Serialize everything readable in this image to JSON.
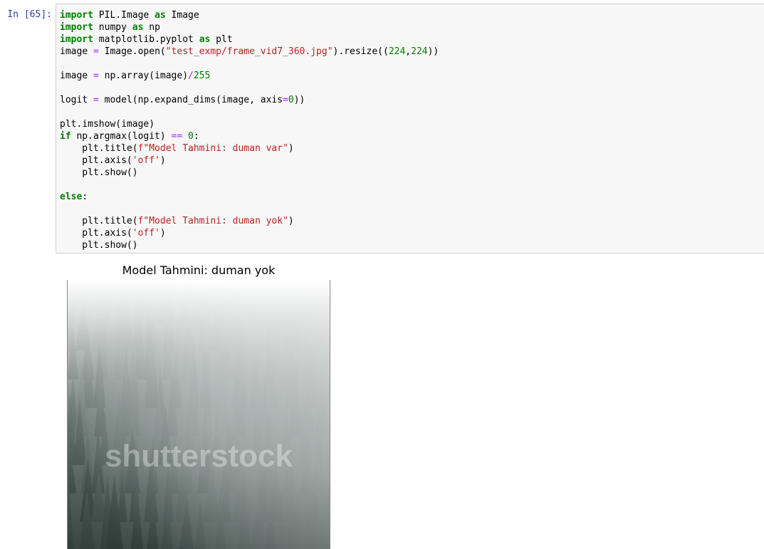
{
  "cell": {
    "prompt": "In [65]:",
    "code_lines": [
      [
        {
          "t": "import",
          "c": "kw"
        },
        {
          "t": " PIL.Image "
        },
        {
          "t": "as",
          "c": "kw"
        },
        {
          "t": " Image"
        }
      ],
      [
        {
          "t": "import",
          "c": "kw"
        },
        {
          "t": " numpy "
        },
        {
          "t": "as",
          "c": "kw"
        },
        {
          "t": " np"
        }
      ],
      [
        {
          "t": "import",
          "c": "kw"
        },
        {
          "t": " matplotlib.pyplot "
        },
        {
          "t": "as",
          "c": "kw"
        },
        {
          "t": " plt"
        }
      ],
      [
        {
          "t": "image "
        },
        {
          "t": "=",
          "c": "op"
        },
        {
          "t": " Image.open("
        },
        {
          "t": "\"test_exmp/frame_vid7_360.jpg\"",
          "c": "st"
        },
        {
          "t": ").resize(("
        },
        {
          "t": "224",
          "c": "nu"
        },
        {
          "t": ","
        },
        {
          "t": "224",
          "c": "nu"
        },
        {
          "t": "))"
        }
      ],
      [],
      [
        {
          "t": "image "
        },
        {
          "t": "=",
          "c": "op"
        },
        {
          "t": " np.array(image)"
        },
        {
          "t": "/",
          "c": "op"
        },
        {
          "t": "255",
          "c": "nu"
        }
      ],
      [],
      [
        {
          "t": "logit "
        },
        {
          "t": "=",
          "c": "op"
        },
        {
          "t": " model(np.expand_dims(image, axis"
        },
        {
          "t": "=",
          "c": "op"
        },
        {
          "t": "0",
          "c": "nu"
        },
        {
          "t": "))"
        }
      ],
      [],
      [
        {
          "t": "plt.imshow(image)"
        }
      ],
      [
        {
          "t": "if",
          "c": "kw"
        },
        {
          "t": " np.argmax(logit) "
        },
        {
          "t": "==",
          "c": "op"
        },
        {
          "t": " "
        },
        {
          "t": "0",
          "c": "nu"
        },
        {
          "t": ":"
        }
      ],
      [
        {
          "t": "    plt.title("
        },
        {
          "t": "f\"Model Tahmini: duman var\"",
          "c": "st"
        },
        {
          "t": ")"
        }
      ],
      [
        {
          "t": "    plt.axis("
        },
        {
          "t": "'off'",
          "c": "st"
        },
        {
          "t": ")"
        }
      ],
      [
        {
          "t": "    plt.show()"
        }
      ],
      [],
      [
        {
          "t": "else",
          "c": "kw"
        },
        {
          "t": ":"
        }
      ],
      [],
      [
        {
          "t": "    plt.title("
        },
        {
          "t": "f\"Model Tahmini: duman yok\"",
          "c": "st"
        },
        {
          "t": ")"
        }
      ],
      [
        {
          "t": "    plt.axis("
        },
        {
          "t": "'off'",
          "c": "st"
        },
        {
          "t": ")"
        }
      ],
      [
        {
          "t": "    plt.show()"
        }
      ]
    ]
  },
  "output": {
    "title": "Model Tahmini: duman yok",
    "image_description_icon": "foggy-forest-image",
    "watermark": "shutterstock"
  },
  "colors": {
    "keyword": "#008000",
    "string": "#ba2121",
    "number": "#008000",
    "operator": "#aa22ff",
    "prompt": "#303f9f"
  }
}
